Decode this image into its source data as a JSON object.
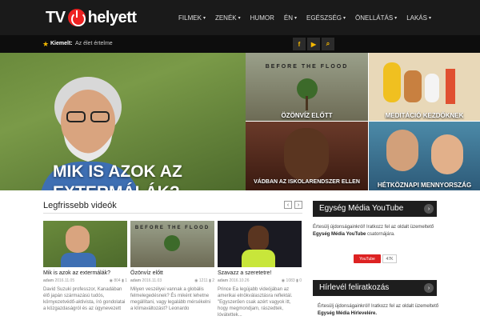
{
  "header": {
    "logo_left": "TV",
    "logo_right": "helyett",
    "nav": [
      {
        "label": "FILMEK",
        "caret": true
      },
      {
        "label": "ZENÉK",
        "caret": true
      },
      {
        "label": "HUMOR",
        "caret": false
      },
      {
        "label": "ÉN",
        "caret": true
      },
      {
        "label": "EGÉSZSÉG",
        "caret": true
      },
      {
        "label": "ÖNELLÁTÁS",
        "caret": true
      },
      {
        "label": "LAKÁS",
        "caret": true
      }
    ]
  },
  "subbar": {
    "highlight_label": "Kiemelt:",
    "highlight_text": "Az élet értelme",
    "social": [
      "f",
      "▶",
      "⌕"
    ]
  },
  "hero": {
    "title": "MIK IS AZOK AZ EXTERMÁLÁK?"
  },
  "tiles": [
    {
      "label": "ÖZÖNVÍZ ELŐTT",
      "image_text": "BEFORE THE FLOOD"
    },
    {
      "label": "MEDITÁCIÓ KEZDŐKNEK"
    },
    {
      "label": "VÁDBAN AZ ISKOLARENDSZER ELLEN"
    },
    {
      "label": "HÉTKÖZNAPI MENNYORSZÁG"
    }
  ],
  "latest": {
    "title": "Legfrissebb videók",
    "cards": [
      {
        "title": "Mik is azok az extermálák?",
        "author": "adam",
        "date": "2016.11.05",
        "views": "804",
        "comments": "1",
        "desc": "David Suzuki professzor, Kanadában élő japán származású tudós, környezetvédő-aktivista, író gondolatai a közgazdaságról és az úgynevezett"
      },
      {
        "title": "Özönvíz előtt",
        "author": "adam",
        "date": "2016.11.03",
        "views": "1211",
        "comments": "2",
        "desc": "Milyen veszélyei vannak a globális felmelegedésnek? És miként lehetne megállítani, vagy legalább mérsékelni a klímaváltozást? Leonardo"
      },
      {
        "title": "Szavazz a szeretetre!",
        "author": "adam",
        "date": "2016.10.26",
        "views": "1083",
        "comments": "0",
        "desc": "Prince Ea legújabb videójában az amerikai elnökválasztásra reflektál. \"Egyszerűen csak azért vagyok itt, hogy megmondjam, rászedtek, lóvátettek..."
      }
    ]
  },
  "sidebar": {
    "youtube_title": "Egység Média YouTube",
    "youtube_text_1": "Értesülj újdonságainkról! Iratkozz fel az oldalt üzemeltető ",
    "youtube_text_bold": "Egység Média YouTube",
    "youtube_text_2": " csatornájára.",
    "youtube_button": "YouTube",
    "youtube_count": "47K",
    "newsletter_title": "Hírlevél feliratkozás",
    "newsletter_text_1": "Értesülj újdonságainkról! Iratkozz fel az oldalt üzemeltető ",
    "newsletter_text_bold": "Egység Média Hírlevelére."
  },
  "colors": {
    "accent": "#e22222",
    "topbar": "#1a1a1a",
    "highlight_star": "#f5b800"
  }
}
